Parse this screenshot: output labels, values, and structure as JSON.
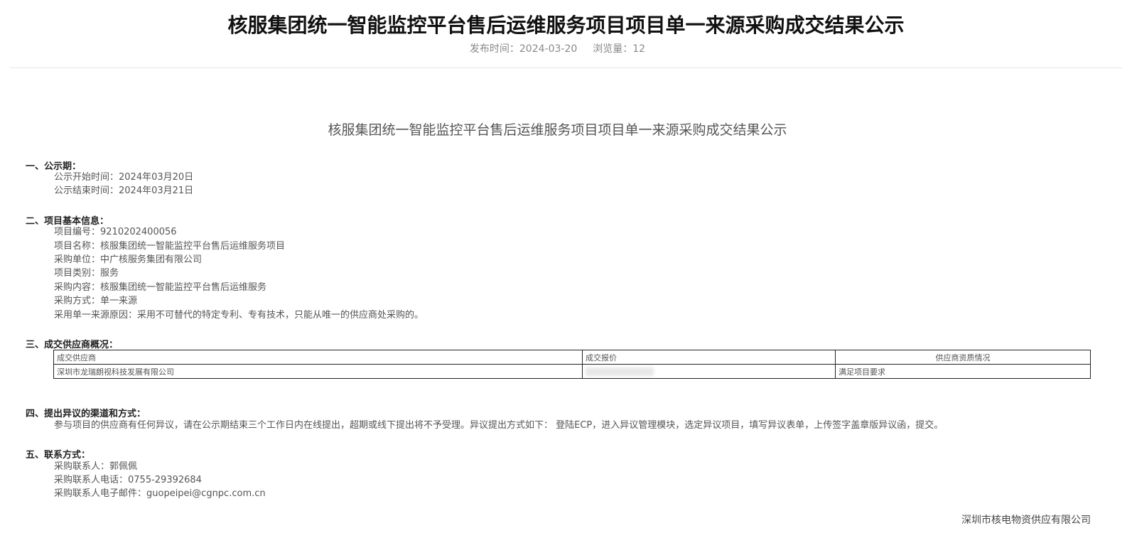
{
  "header": {
    "title": "核服集团统一智能监控平台售后运维服务项目项目单一来源采购成交结果公示",
    "publish_label": "发布时间：",
    "publish_date": "2024-03-20",
    "views_label": "浏览量：",
    "views": "12"
  },
  "doc_title": "核服集团统一智能监控平台售后运维服务项目项目单一来源采购成交结果公示",
  "sections": {
    "period": {
      "heading": "一、公示期：",
      "lines": [
        "公示开始时间：2024年03月20日",
        "公示结束时间：2024年03月21日"
      ]
    },
    "basic": {
      "heading": "二、项目基本信息：",
      "lines": [
        "项目编号：9210202400056",
        "项目名称：核服集团统一智能监控平台售后运维服务项目",
        "采购单位：中广核服务集团有限公司",
        "项目类别：服务",
        "采购内容：核服集团统一智能监控平台售后运维服务",
        "采购方式：单一来源",
        "采用单一来源原因：采用不可替代的特定专利、专有技术，只能从唯一的供应商处采购的。"
      ]
    },
    "supplier": {
      "heading": "三、成交供应商概况：",
      "columns": [
        "成交供应商",
        "成交报价",
        "供应商资质情况"
      ],
      "rows": [
        {
          "name": "深圳市龙瑞朗视科技发展有限公司",
          "price": "",
          "qualification": "满足项目要求"
        }
      ]
    },
    "objection": {
      "heading": "四、提出异议的渠道和方式：",
      "lines": [
        "参与项目的供应商有任何异议，请在公示期结束三个工作日内在线提出，超期或线下提出将不予受理。异议提出方式如下： 登陆ECP，进入异议管理模块，选定异议项目，填写异议表单，上传签字盖章版异议函，提交。"
      ]
    },
    "contact": {
      "heading": "五、联系方式：",
      "lines": [
        "采购联系人：郭佩佩",
        "采购联系人电话：0755-29392684",
        "采购联系人电子邮件：guopeipei@cgnpc.com.cn"
      ]
    }
  },
  "footer": {
    "org": "深圳市核电物资供应有限公司"
  }
}
